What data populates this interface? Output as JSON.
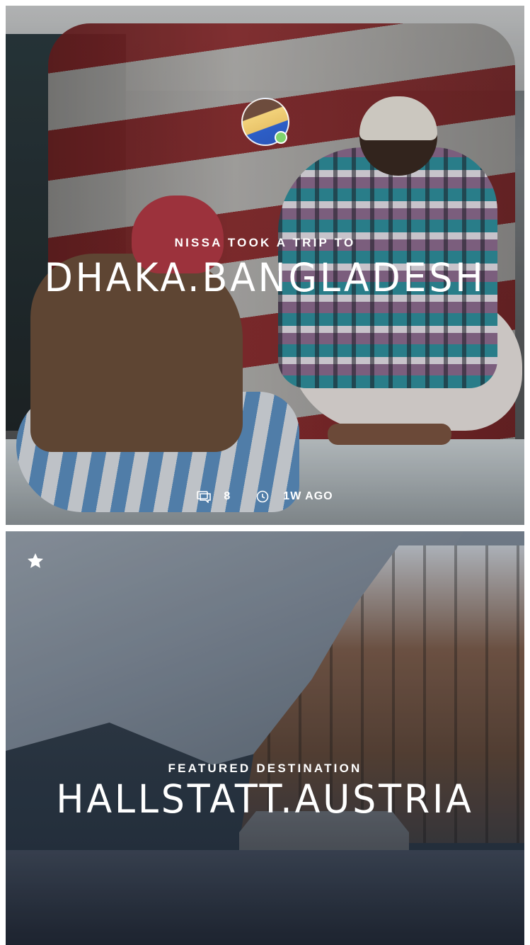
{
  "cards": [
    {
      "author": "Nissa",
      "eyebrow": "NISSA TOOK A TRIP TO",
      "headline": "DHAKA.BANGLADESH",
      "comments_count": "8",
      "time_ago": "1W AGO",
      "avatar_status_color": "#7fd36e"
    },
    {
      "eyebrow": "FEATURED DESTINATION",
      "headline": "HALLSTATT.AUSTRIA",
      "badge_icon": "star-icon"
    }
  ],
  "icons": {
    "comments": "comment-bubble-icon",
    "time": "clock-icon",
    "featured": "star-icon"
  },
  "colors": {
    "text": "#ffffff",
    "background": "#ffffff",
    "online": "#7fd36e"
  }
}
